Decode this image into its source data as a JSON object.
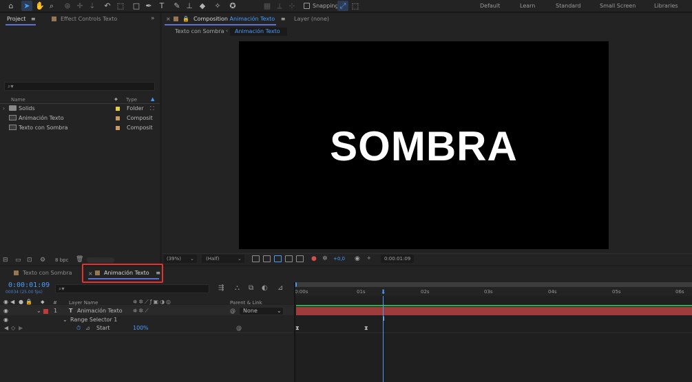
{
  "toolbar": {
    "snapping_label": "Snapping",
    "workspaces": [
      "Default",
      "Learn",
      "Standard",
      "Small Screen",
      "Libraries"
    ]
  },
  "project": {
    "tab_project": "Project",
    "tab_effect_controls": "Effect Controls Texto",
    "search_placeholder": "",
    "col_name": "Name",
    "col_type": "Type",
    "bpc": "8 bpc",
    "items": [
      {
        "name": "Solids",
        "label_color": "#e5cf3c",
        "type": "Folder"
      },
      {
        "name": "Animación Texto",
        "label_color": "#c79a68",
        "type": "Composit"
      },
      {
        "name": "Texto con Sombra",
        "label_color": "#c79a68",
        "type": "Composit"
      }
    ]
  },
  "composition": {
    "tab_prefix": "Composition",
    "tab_name": "Animación Texto",
    "layer_tab": "Layer (none)",
    "breadcrumb_1": "Texto con Sombra",
    "breadcrumb_2": "Animación Texto",
    "viewer_text": "SOMBRA",
    "zoom": "(39%)",
    "resolution": "(Half)",
    "exposure": "+0,0",
    "timecode": "0:00:01:09"
  },
  "timeline": {
    "tab_1": "Texto con Sombra",
    "tab_2": "Animación Texto",
    "current_time": "0:00:01:09",
    "frame_info": "00034 (25.00 fps)",
    "search_placeholder": "",
    "col_num": "#",
    "col_layer_name": "Layer Name",
    "col_parent": "Parent & Link",
    "layer_num": "1",
    "layer_type_icon": "T",
    "layer_name": "Animación Texto",
    "parent_value": "None",
    "range_selector": "Range Selector 1",
    "property_name": "Start",
    "property_value": "100",
    "property_unit": "%",
    "ruler": [
      "0:00s",
      "01s",
      "02s",
      "03s",
      "04s",
      "05s",
      "06s"
    ],
    "playhead_fraction": 0.22
  },
  "colors": {
    "accent_blue": "#4a9dff",
    "highlight_red": "#e5322f",
    "layer_bar": "#9e3b3b",
    "work_area_green": "#2bb24c"
  }
}
